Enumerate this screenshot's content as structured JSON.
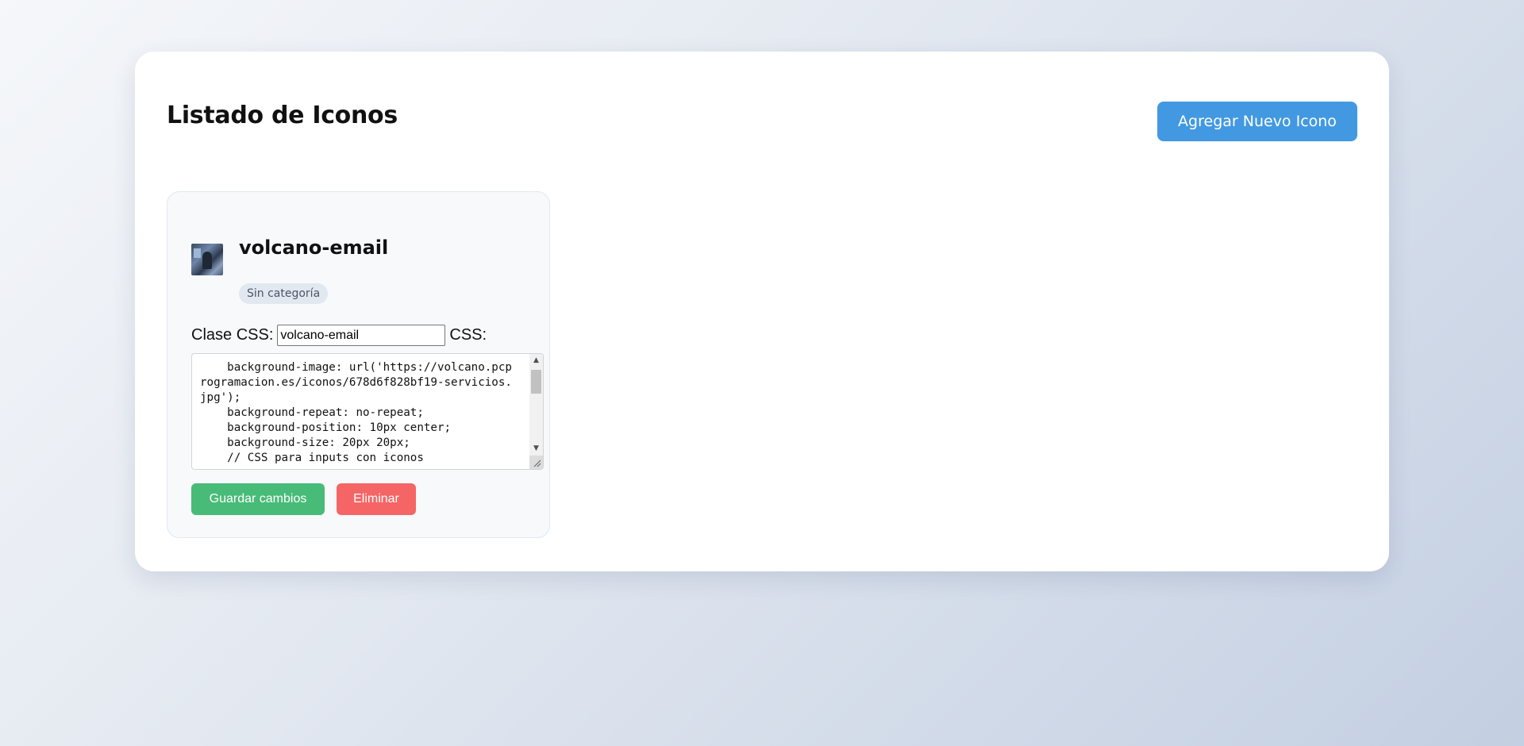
{
  "header": {
    "title": "Listado de Iconos",
    "add_button_label": "Agregar Nuevo Icono"
  },
  "icons": [
    {
      "name": "volcano-email",
      "category": "Sin categoría",
      "class_label": "Clase CSS:",
      "class_value": "volcano-email",
      "css_label": "CSS:",
      "css_code": "    background-image: url('https://volcano.pcprogramacion.es/iconos/678d6f828bf19-servicios.jpg');\n    background-repeat: no-repeat;\n    background-position: 10px center;\n    background-size: 20px 20px;\n    // CSS para inputs con iconos",
      "save_label": "Guardar cambios",
      "delete_label": "Eliminar"
    }
  ],
  "colors": {
    "primary": "#4299e1",
    "save": "#48bb78",
    "delete": "#f56565",
    "badge_bg": "#e2e8f0"
  }
}
